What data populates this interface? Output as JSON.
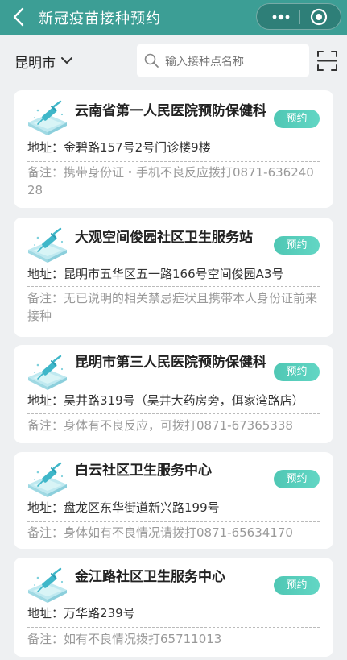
{
  "header": {
    "title": "新冠疫苗接种预约"
  },
  "filter": {
    "city": "昆明市",
    "search_placeholder": "输入接种点名称"
  },
  "book_label": "预约",
  "sites": [
    {
      "name": "云南省第一人民医院预防保健科",
      "address": "地址：金碧路157号2号门诊楼9楼",
      "note": "备注：携带身份证・手机不良反应拨打0871-63624028"
    },
    {
      "name": "大观空间俊园社区卫生服务站",
      "address": "地址：昆明市五华区五一路166号空间俊园A3号",
      "note": "备注：无已说明的相关禁忌症状且携带本人身份证前来接种"
    },
    {
      "name": "昆明市第三人民医院预防保健科",
      "address": "地址：吴井路319号（吴井大药房旁，佴家湾路店）",
      "note": "备注：身体有不良反应，可拨打0871-67365338"
    },
    {
      "name": "白云社区卫生服务中心",
      "address": "地址：盘龙区东华街道新兴路199号",
      "note": "备注：身体如有不良情况请拨打0871-65634170"
    },
    {
      "name": "金江路社区卫生服务中心",
      "address": "地址：万华路239号",
      "note": "备注：如有不良情况拨打65711013"
    }
  ]
}
